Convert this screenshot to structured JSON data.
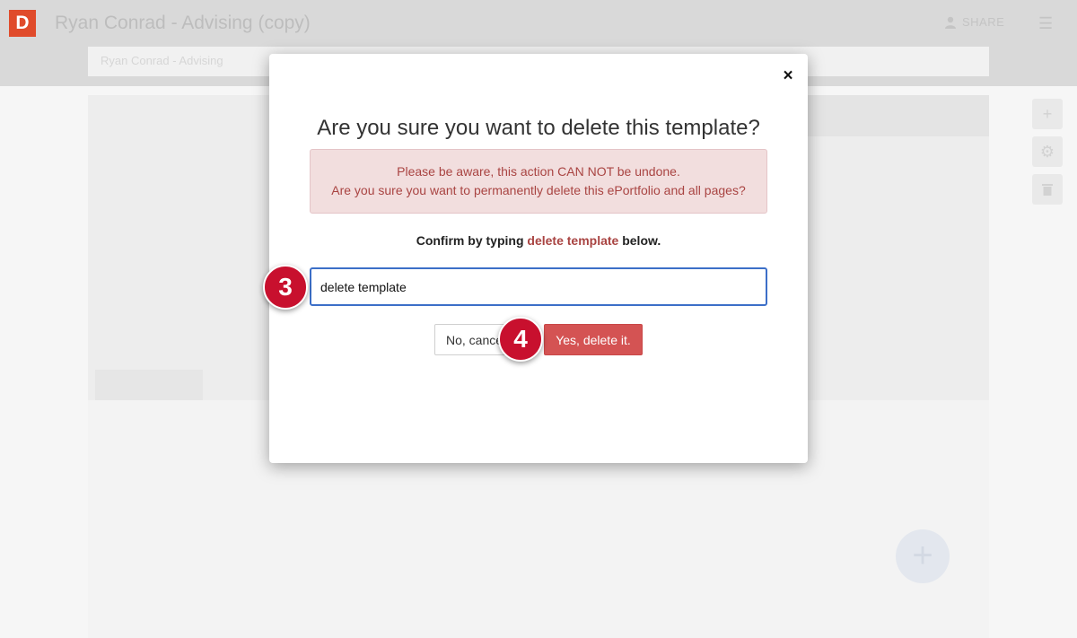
{
  "app": {
    "logo_letter": "D",
    "title": "Ryan Conrad - Advising (copy)",
    "share_label": "SHARE",
    "menu_icon": "hamburger-icon",
    "subbar_text": "Ryan Conrad - Advising",
    "side_tools": [
      "plus-icon",
      "gear-icon",
      "trash-icon"
    ],
    "fab_icon": "plus-icon"
  },
  "modal": {
    "close_label": "×",
    "title": "Are you sure you want to delete this template?",
    "alert": {
      "line1": "Please be aware, this action CAN NOT be undone.",
      "line2": "Are you sure you want to permanently delete this ePortfolio and all pages?"
    },
    "confirm": {
      "prefix": "Confirm by typing ",
      "keyword": "delete template",
      "suffix": " below."
    },
    "input_value": "delete template",
    "cancel_label": "No, cancel",
    "delete_label": "Yes, delete it."
  },
  "markers": {
    "step3": "3",
    "step4": "4"
  },
  "colors": {
    "logo": "#e04b2b",
    "alert_text": "#a94442",
    "alert_bg": "#f2dede",
    "delete_button": "#d45353",
    "input_border": "#3c6fc8",
    "marker": "#c8102e"
  }
}
